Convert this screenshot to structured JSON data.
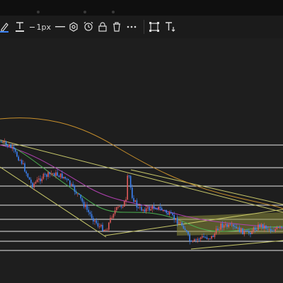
{
  "app": {
    "toolbar": {
      "line_width_label": "1px",
      "items": [
        {
          "name": "pencil-icon"
        },
        {
          "name": "text-color-icon"
        },
        {
          "name": "line-width-selector"
        },
        {
          "name": "line-style-icon"
        },
        {
          "name": "settings-icon"
        },
        {
          "name": "alert-icon"
        },
        {
          "name": "lock-icon"
        },
        {
          "name": "trash-icon"
        },
        {
          "name": "more-icon"
        },
        {
          "name": "visual-order-icon"
        },
        {
          "name": "clone-icon"
        },
        {
          "name": "text-tool-icon"
        }
      ]
    },
    "colors": {
      "background": "#1e1e1e",
      "up_candle": "#e05a5a",
      "down_candle": "#3b82f6",
      "horizontal_lines": "#e8e8e8",
      "trend_lines": "#c8c86a",
      "ma_long": "#c9902c",
      "ma_mid": "#b040b0",
      "ma_short": "#4caf50",
      "highlight_zone": "#8a8a3a"
    }
  }
}
